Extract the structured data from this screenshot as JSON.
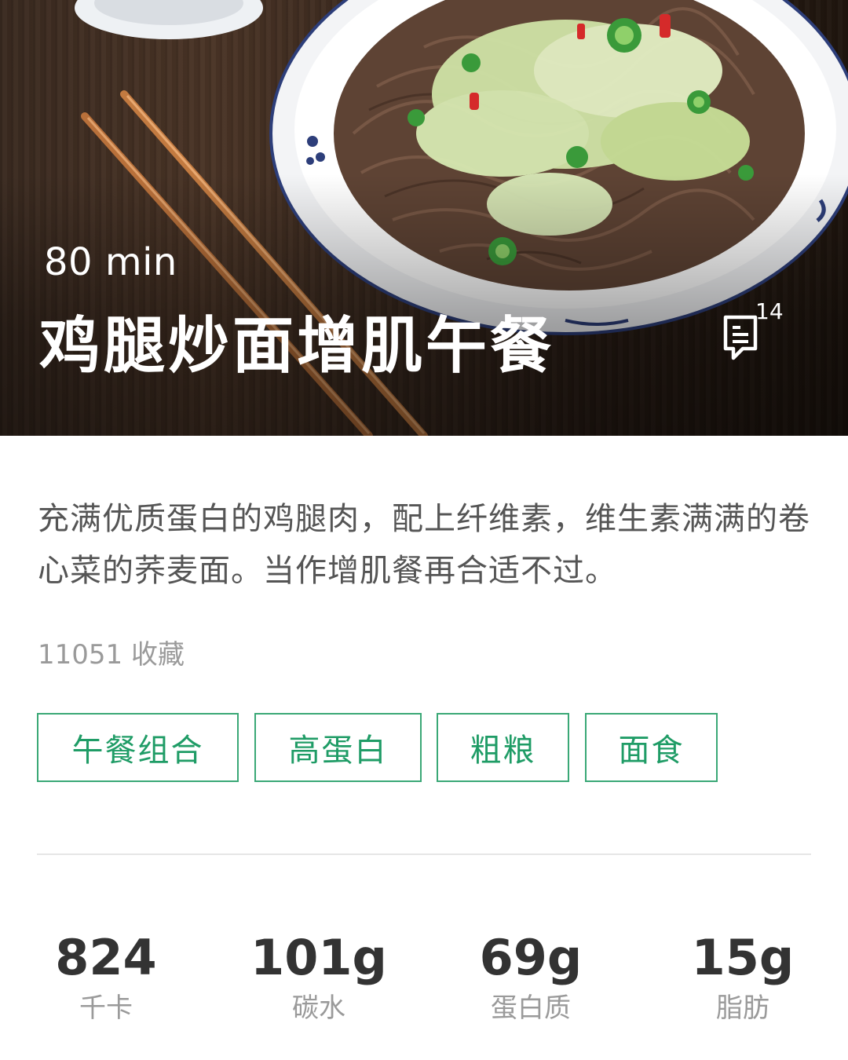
{
  "hero": {
    "duration": "80 min",
    "title": "鸡腿炒面增肌午餐",
    "comment_count": "14"
  },
  "description": "充满优质蛋白的鸡腿肉，配上纤维素，维生素满满的卷心菜的荞麦面。当作增肌餐再合适不过。",
  "favorites": "11051 收藏",
  "tags": [
    "午餐组合",
    "高蛋白",
    "粗粮",
    "面食"
  ],
  "nutrition": [
    {
      "value": "824",
      "label": "千卡"
    },
    {
      "value": "101g",
      "label": "碳水"
    },
    {
      "value": "69g",
      "label": "蛋白质"
    },
    {
      "value": "15g",
      "label": "脂肪"
    }
  ],
  "colors": {
    "accent": "#1f9c66",
    "tag_border": "#3aa876",
    "text_primary": "#333333",
    "text_secondary": "#555555",
    "text_muted": "#9a9a9a"
  },
  "icons": {
    "comment": "comment-icon"
  }
}
